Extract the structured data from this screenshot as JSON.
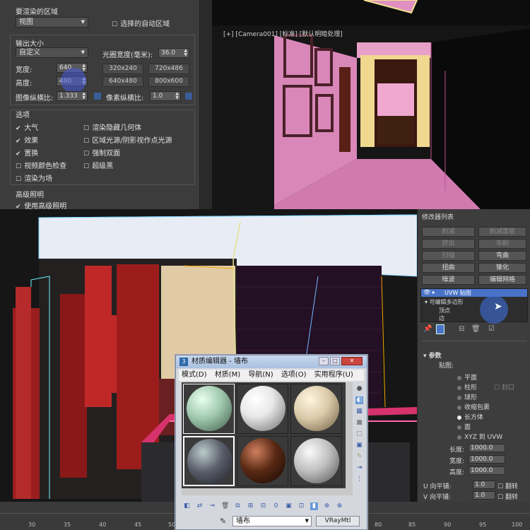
{
  "render_panel": {
    "area_section_label": "要渲染的区域",
    "area_dropdown": "视图",
    "auto_region_checkbox": "选择的自动区域",
    "output_size_label": "输出大小",
    "size_dropdown": "自定义",
    "aperture_label": "光圈宽度(毫米):",
    "aperture_value": "36.0",
    "width_label": "宽度:",
    "width_value": "640",
    "height_label": "高度:",
    "height_value": "480",
    "presets": [
      "320x240",
      "720x486",
      "640x480",
      "800x600"
    ],
    "aspect_label": "图像纵横比:",
    "aspect_value": "1.333",
    "pixel_aspect_label": "像素纵横比:",
    "pixel_aspect_value": "1.0",
    "options_label": "选项",
    "options_left": [
      {
        "label": "大气",
        "checked": true
      },
      {
        "label": "效果",
        "checked": true
      },
      {
        "label": "置换",
        "checked": true
      },
      {
        "label": "视频颜色检查",
        "checked": false
      },
      {
        "label": "渲染为场",
        "checked": false
      }
    ],
    "options_right": [
      {
        "label": "渲染隐藏几何体",
        "checked": false
      },
      {
        "label": "区域光源/阴影视作点光源",
        "checked": false
      },
      {
        "label": "强制双面",
        "checked": false
      },
      {
        "label": "超级黑",
        "checked": false
      }
    ],
    "advanced_label": "高级照明",
    "advanced_checkbox": "使用高级照明"
  },
  "camera_view": {
    "label": "[+] [Camera001] [标准] [默认明暗处理]"
  },
  "modifier_panel": {
    "title": "修改器列表",
    "buttons": [
      {
        "label": "削减",
        "enabled": false
      },
      {
        "label": "削减面能",
        "enabled": false
      },
      {
        "label": "挤出",
        "enabled": false
      },
      {
        "label": "车削",
        "enabled": false
      },
      {
        "label": "扫描",
        "enabled": false
      },
      {
        "label": "弯曲",
        "enabled": true
      },
      {
        "label": "扭曲",
        "enabled": true
      },
      {
        "label": "锥化",
        "enabled": true
      },
      {
        "label": "噪波",
        "enabled": true
      },
      {
        "label": "编辑网格",
        "enabled": true
      }
    ],
    "stack": {
      "uvw": "UVW 贴图",
      "editpoly": "可编辑多边形",
      "vertex": "顶点",
      "edge": "边"
    },
    "params_label": "参数",
    "mapping_label": "贴图:",
    "mapping_options": [
      {
        "label": "平面",
        "selected": false
      },
      {
        "label": "柱形",
        "selected": false
      },
      {
        "label": "球形",
        "selected": false
      },
      {
        "label": "收缩包裹",
        "selected": false
      },
      {
        "label": "长方体",
        "selected": true
      },
      {
        "label": "面",
        "selected": false
      },
      {
        "label": "XYZ 到 UVW",
        "selected": false
      }
    ],
    "cap_label": "封口",
    "length_label": "长度:",
    "length_value": "1000.0",
    "width_label": "宽度:",
    "width_value": "1000.0",
    "height_label": "高度:",
    "height_value": "1000.0",
    "u_tile_label": "U 向平铺:",
    "u_tile_value": "1.0",
    "v_tile_label": "V 向平铺:",
    "v_tile_value": "1.0",
    "flip_label": "翻转"
  },
  "material_editor": {
    "title": "材质编辑器 - 墙布",
    "menus": [
      "模式(D)",
      "材质(M)",
      "导航(N)",
      "选项(O)",
      "实用程序(U)"
    ],
    "material_name": "墙布",
    "material_type": "VRayMtl",
    "slots": [
      {
        "color": "#9fc8ad"
      },
      {
        "color": "#e8e8e8"
      },
      {
        "color": "#d9c9a8"
      },
      {
        "color": "#5a5e6a"
      },
      {
        "color": "#5a2a14"
      },
      {
        "color": "#c0c0c0"
      }
    ]
  },
  "timeline": {
    "ticks": [
      "30",
      "35",
      "40",
      "45",
      "50",
      "80",
      "85",
      "90",
      "95",
      "100"
    ]
  },
  "colors": {
    "panel_bg": "#3c3c3c",
    "accent_blue": "#4a73c8",
    "wall_pink": "#d987b4"
  }
}
